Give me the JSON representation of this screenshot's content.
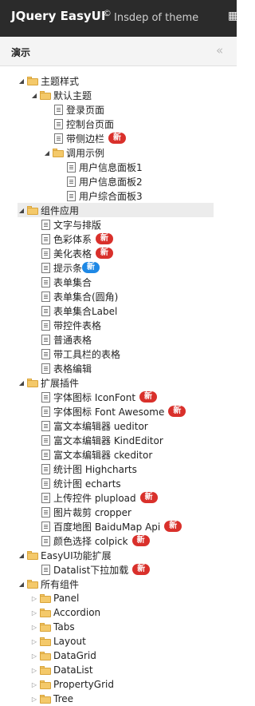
{
  "header": {
    "brand": "JQuery EasyUI",
    "copyright": "©",
    "subtitle": "Insdep of theme",
    "icon": "grid-icon"
  },
  "panel": {
    "title": "演示",
    "collapse_glyph": "«"
  },
  "badges": {
    "new": "新"
  },
  "tree": [
    {
      "label": "主题样式",
      "type": "folder",
      "open": true,
      "level": 1
    },
    {
      "label": "默认主题",
      "type": "folder",
      "open": true,
      "level": 2
    },
    {
      "label": "登录页面",
      "type": "file",
      "level": 3
    },
    {
      "label": "控制台页面",
      "type": "file",
      "level": 3
    },
    {
      "label": "带侧边栏",
      "type": "file",
      "level": 3,
      "badge": "新"
    },
    {
      "label": "调用示例",
      "type": "folder",
      "open": true,
      "level": 3
    },
    {
      "label": "用户信息面板1",
      "type": "file",
      "level": 4
    },
    {
      "label": "用户信息面板2",
      "type": "file",
      "level": 4
    },
    {
      "label": "用户综合面板3",
      "type": "file",
      "level": 4
    },
    {
      "label": "组件应用",
      "type": "folder",
      "open": true,
      "level": 1,
      "selected": true
    },
    {
      "label": "文字与排版",
      "type": "file",
      "level": 2
    },
    {
      "label": "色彩体系",
      "type": "file",
      "level": 2,
      "badge": "新"
    },
    {
      "label": "美化表格",
      "type": "file",
      "level": 2,
      "badge": "新"
    },
    {
      "label": "提示条",
      "type": "file",
      "level": 2,
      "badge": "新",
      "badge_color": "blue"
    },
    {
      "label": "表单集合",
      "type": "file",
      "level": 2
    },
    {
      "label": "表单集合(圆角)",
      "type": "file",
      "level": 2
    },
    {
      "label": "表单集合Label",
      "type": "file",
      "level": 2
    },
    {
      "label": "带控件表格",
      "type": "file",
      "level": 2
    },
    {
      "label": "普通表格",
      "type": "file",
      "level": 2
    },
    {
      "label": "带工具栏的表格",
      "type": "file",
      "level": 2
    },
    {
      "label": "表格编辑",
      "type": "file",
      "level": 2
    },
    {
      "label": "扩展插件",
      "type": "folder",
      "open": true,
      "level": 1
    },
    {
      "label": "字体图标 IconFont",
      "type": "file",
      "level": 2,
      "badge": "新"
    },
    {
      "label": "字体图标 Font Awesome",
      "type": "file",
      "level": 2,
      "badge": "新"
    },
    {
      "label": "富文本编辑器 ueditor",
      "type": "file",
      "level": 2
    },
    {
      "label": "富文本编辑器 KindEditor",
      "type": "file",
      "level": 2
    },
    {
      "label": "富文本编辑器 ckeditor",
      "type": "file",
      "level": 2
    },
    {
      "label": "统计图 Highcharts",
      "type": "file",
      "level": 2
    },
    {
      "label": "统计图 echarts",
      "type": "file",
      "level": 2
    },
    {
      "label": "上传控件 plupload",
      "type": "file",
      "level": 2,
      "badge": "新"
    },
    {
      "label": "图片裁剪 cropper",
      "type": "file",
      "level": 2
    },
    {
      "label": "百度地图 BaiduMap Api",
      "type": "file",
      "level": 2,
      "badge": "新"
    },
    {
      "label": "颜色选择 colpick",
      "type": "file",
      "level": 2,
      "badge": "新"
    },
    {
      "label": "EasyUI功能扩展",
      "type": "folder",
      "open": true,
      "level": 1
    },
    {
      "label": "Datalist下拉加载",
      "type": "file",
      "level": 2,
      "badge": "新"
    },
    {
      "label": "所有组件",
      "type": "folder",
      "open": true,
      "level": 1
    },
    {
      "label": "Panel",
      "type": "folder",
      "open": false,
      "level": 2
    },
    {
      "label": "Accordion",
      "type": "folder",
      "open": false,
      "level": 2
    },
    {
      "label": "Tabs",
      "type": "folder",
      "open": false,
      "level": 2
    },
    {
      "label": "Layout",
      "type": "folder",
      "open": false,
      "level": 2
    },
    {
      "label": "DataGrid",
      "type": "folder",
      "open": false,
      "level": 2
    },
    {
      "label": "DataList",
      "type": "folder",
      "open": false,
      "level": 2
    },
    {
      "label": "PropertyGrid",
      "type": "folder",
      "open": false,
      "level": 2
    },
    {
      "label": "Tree",
      "type": "folder",
      "open": false,
      "level": 2
    }
  ]
}
